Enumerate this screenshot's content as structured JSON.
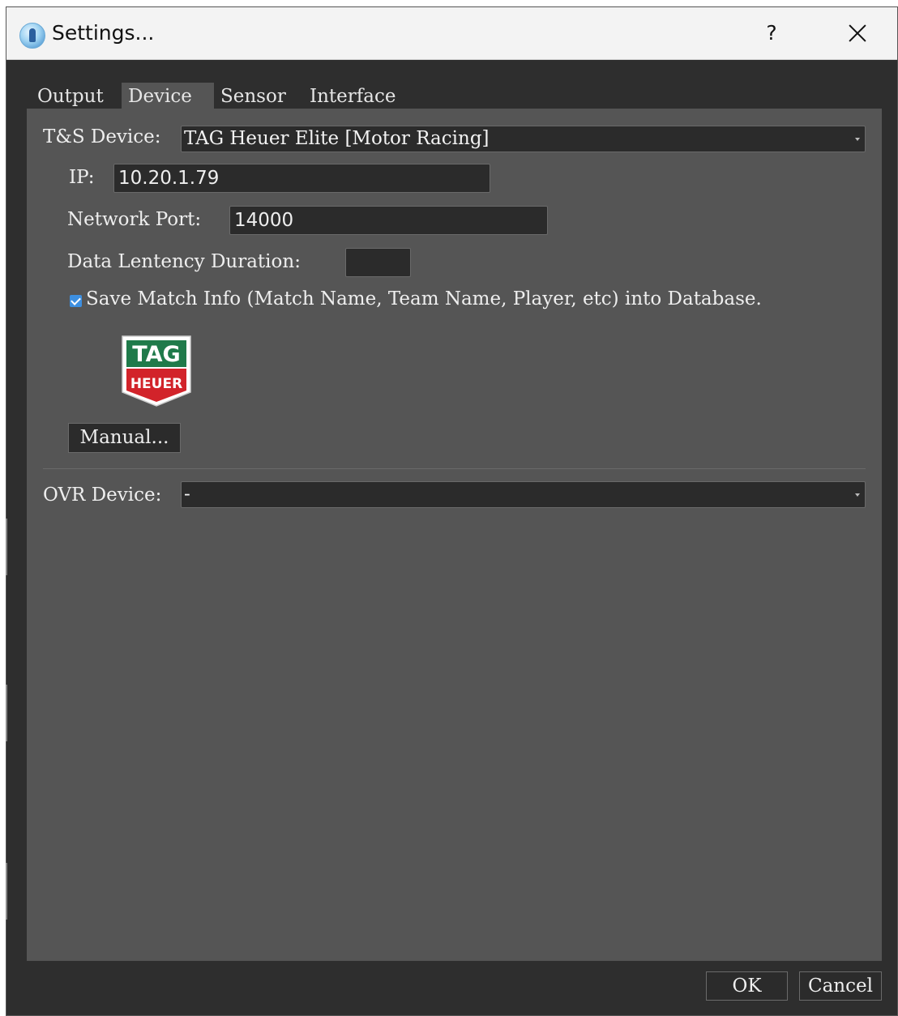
{
  "window": {
    "title": "Settings...",
    "help_label": "?",
    "accent_color": "#8a5cf0"
  },
  "tabs": [
    {
      "label": "Output",
      "active": false
    },
    {
      "label": "Device",
      "active": true
    },
    {
      "label": "Sensor",
      "active": false
    },
    {
      "label": "Interface",
      "active": false
    }
  ],
  "device": {
    "ts_device_label": "T&S Device:",
    "ts_device_value": "TAG Heuer Elite [Motor Racing]",
    "ip_label": "IP:",
    "ip_value": "10.20.1.79",
    "port_label": "Network Port:",
    "port_value": "14000",
    "latency_label": "Data Lentency Duration:",
    "latency_value": "",
    "save_match_checked": true,
    "save_match_label": "Save Match Info (Match Name, Team Name, Player, etc) into Database.",
    "logo_top_text": "TAG",
    "logo_bottom_text": "HEUER",
    "manual_button": "Manual...",
    "ovr_device_label": "OVR Device:",
    "ovr_device_value": "-"
  },
  "footer": {
    "ok_label": "OK",
    "cancel_label": "Cancel"
  },
  "icons": {
    "app": "app-icon",
    "close": "close-icon",
    "dropdown": "chevron-down-icon",
    "check": "checkmark-icon"
  },
  "colors": {
    "panel_bg": "#555555",
    "window_bg": "#2e2e2e",
    "field_bg": "#2b2b2b",
    "checkbox": "#3d8fe0",
    "logo_green": "#1f7a4a",
    "logo_red": "#d2232a"
  }
}
